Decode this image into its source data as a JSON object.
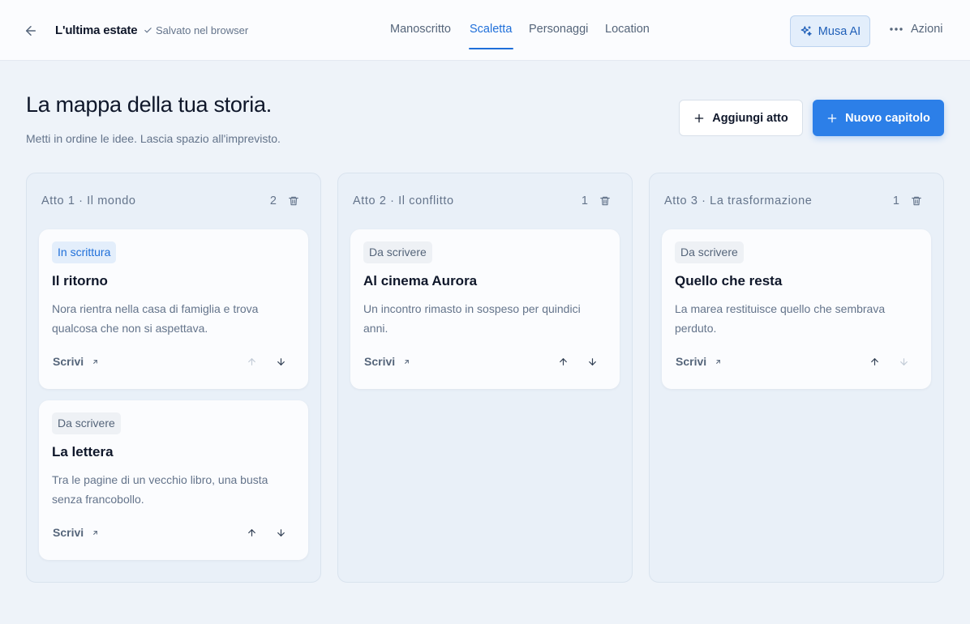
{
  "header": {
    "doc_title": "L'ultima estate",
    "save_status": "Salvato nel browser",
    "tabs": [
      {
        "label": "Manoscritto"
      },
      {
        "label": "Scaletta"
      },
      {
        "label": "Personaggi"
      },
      {
        "label": "Location"
      }
    ],
    "active_tab": "Scaletta",
    "musa_label": "Musa AI",
    "actions_label": "Azioni"
  },
  "page": {
    "title": "La mappa della tua storia.",
    "subtitle": "Metti in ordine le idee. Lascia spazio all'imprevisto.",
    "add_act_label": "Aggiungi atto",
    "new_chapter_label": "Nuovo capitolo"
  },
  "acts": [
    {
      "title": "Atto 1 · Il mondo",
      "count": "2",
      "cards": [
        {
          "status": "In scrittura",
          "title": "Il ritorno",
          "description": "Nora rientra nella casa di famiglia e trova qualcosa che non si aspettava.",
          "write_label": "Scrivi"
        },
        {
          "status": "Da scrivere",
          "title": "La lettera",
          "description": "Tra le pagine di un vecchio libro, una busta senza francobollo.",
          "write_label": "Scrivi"
        }
      ]
    },
    {
      "title": "Atto 2 · Il conflitto",
      "count": "1",
      "cards": [
        {
          "status": "Da scrivere",
          "title": "Al cinema Aurora",
          "description": "Un incontro rimasto in sospeso per quindici anni.",
          "write_label": "Scrivi"
        }
      ]
    },
    {
      "title": "Atto 3 · La trasformazione",
      "count": "1",
      "cards": [
        {
          "status": "Da scrivere",
          "title": "Quello che resta",
          "description": "La marea restituisce quello che sembrava perduto.",
          "write_label": "Scrivi"
        }
      ]
    }
  ],
  "colors": {
    "accent": "#2c7fe8",
    "accent_text": "#1f6fd9",
    "background": "#eef3f9",
    "column": "#e9f0f8"
  },
  "icons": {
    "back": "arrow-left-icon",
    "saved": "check-icon",
    "musa": "sparkles-icon",
    "actions": "more-horizontal-icon",
    "add": "plus-icon",
    "delete": "trash-icon",
    "write": "arrow-up-right-icon",
    "move_up": "arrow-up-icon",
    "move_down": "arrow-down-icon"
  }
}
